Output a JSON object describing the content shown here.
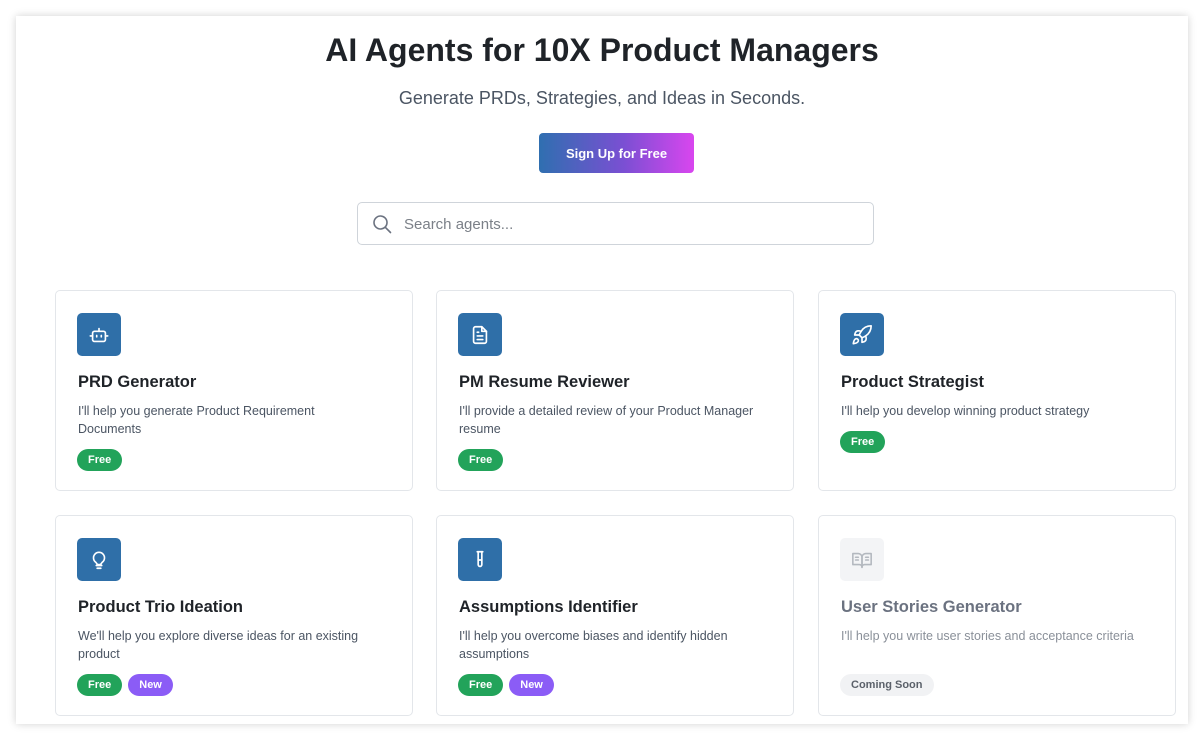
{
  "header": {
    "title": "AI Agents for 10X Product Managers",
    "subtitle": "Generate PRDs, Strategies, and Ideas in Seconds.",
    "signup_label": "Sign Up for Free"
  },
  "search": {
    "placeholder": "Search agents...",
    "value": ""
  },
  "icons": {
    "search": "search-icon",
    "prd": "robot-icon",
    "resume": "document-icon",
    "strategist": "rocket-icon",
    "ideation": "lightbulb-icon",
    "assumptions": "test-tube-icon",
    "stories": "book-open-icon"
  },
  "colors": {
    "icon_bg": "#2f6fa8",
    "free": "#22a35a",
    "new": "#8b5cf6",
    "gradient_start": "#2f6fb0",
    "gradient_end": "#d946ef"
  },
  "cards": [
    {
      "name": "PRD Generator",
      "description": "I'll help you generate Product Requirement Documents",
      "badges": [
        "Free"
      ]
    },
    {
      "name": "PM Resume Reviewer",
      "description": "I'll provide a detailed review of your Product Manager resume",
      "badges": [
        "Free"
      ]
    },
    {
      "name": "Product Strategist",
      "description": "I'll help you develop winning product strategy",
      "badges": [
        "Free"
      ]
    },
    {
      "name": "Product Trio Ideation",
      "description": "We'll help you explore diverse ideas for an existing product",
      "badges": [
        "Free",
        "New"
      ]
    },
    {
      "name": "Assumptions Identifier",
      "description": "I'll help you overcome biases and identify hidden assumptions",
      "badges": [
        "Free",
        "New"
      ]
    },
    {
      "name": "User Stories Generator",
      "description": "I'll help you write user stories and acceptance criteria",
      "badges": [
        "Coming Soon"
      ]
    }
  ]
}
